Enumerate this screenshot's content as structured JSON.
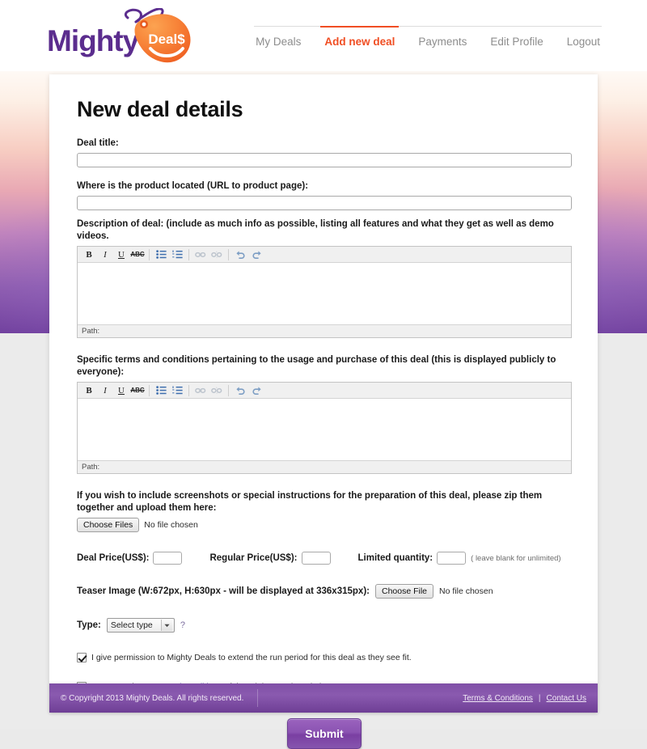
{
  "brand": {
    "logo_word": "Mighty",
    "logo_tag_text": "Deal$",
    "purple": "#5b2d8e",
    "orange": "#f47b27",
    "accent_red": "#f04e23"
  },
  "nav": {
    "items": [
      {
        "label": "My Deals",
        "active": false
      },
      {
        "label": "Add new deal",
        "active": true
      },
      {
        "label": "Payments",
        "active": false
      },
      {
        "label": "Edit Profile",
        "active": false
      },
      {
        "label": "Logout",
        "active": false
      }
    ]
  },
  "page": {
    "title": "New deal details"
  },
  "form": {
    "deal_title": {
      "label": "Deal title:",
      "value": "",
      "placeholder": ""
    },
    "product_url": {
      "label": "Where is the product located (URL to product page):",
      "value": "",
      "placeholder": ""
    },
    "description": {
      "label": "Description of deal: (include as much info as possible, listing all features and what they get as well as demo videos.",
      "value": "",
      "status": "Path:"
    },
    "terms_editor": {
      "label": "Specific terms and conditions pertaining to the usage and purchase of this deal (this is displayed publicly to everyone):",
      "value": "",
      "status": "Path:"
    },
    "editor_toolbar": {
      "bold": "B",
      "italic": "I",
      "underline": "U",
      "strikethrough": "ABC",
      "bullet_list": "unordered-list-icon",
      "numbered_list": "ordered-list-icon",
      "link": "link-icon",
      "unlink": "unlink-icon",
      "undo": "undo-icon",
      "redo": "redo-icon"
    },
    "zip_upload": {
      "label": "If you wish to include screenshots or special instructions for the preparation of this deal, please zip them together and upload them here:",
      "button": "Choose Files",
      "status": "No file chosen"
    },
    "deal_price": {
      "label": "Deal Price(US$):",
      "value": ""
    },
    "regular_price": {
      "label": "Regular Price(US$):",
      "value": ""
    },
    "limited_quantity": {
      "label": "Limited quantity:",
      "value": "",
      "hint": "( leave blank for unlimited)"
    },
    "teaser_image": {
      "label": "Teaser Image (W:672px, H:630px - will be displayed at 336x315px):",
      "button": "Choose File",
      "status": "No file chosen"
    },
    "type": {
      "label": "Type:",
      "selected": "Select type",
      "options": [
        "Select type"
      ],
      "help": "?"
    },
    "permission_checkbox": {
      "checked": true,
      "text": "I give permission to Mighty Deals to extend the run period for this deal as they see fit."
    },
    "terms_checkbox": {
      "checked": false,
      "text_before": "I agree to the ",
      "link_text": "terms and conditions",
      "text_after": " of the Mighty Deals website"
    },
    "submit": {
      "label": "Submit"
    }
  },
  "footer": {
    "copyright": "© Copyright 2013 Mighty Deals. All rights reserved.",
    "links": [
      {
        "label": "Terms & Conditions"
      },
      {
        "label": "Contact Us"
      }
    ],
    "separator": "|"
  }
}
